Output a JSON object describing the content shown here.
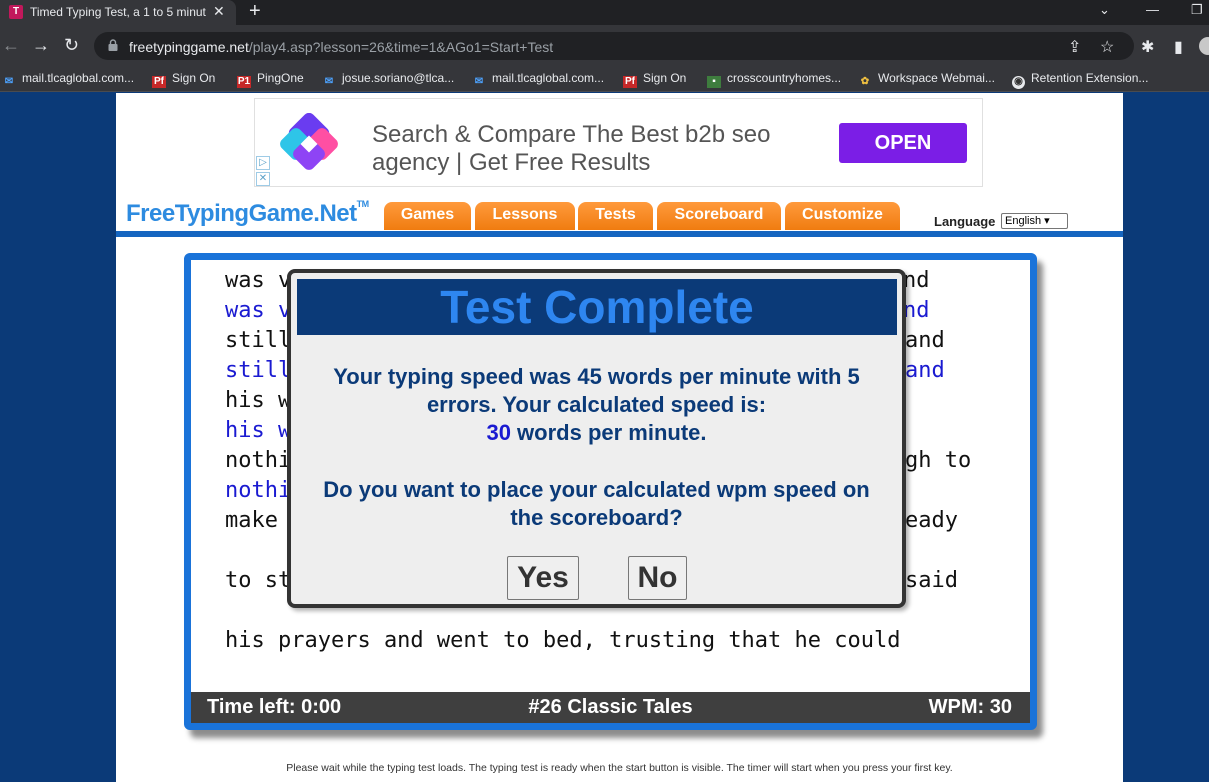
{
  "browser": {
    "tab": {
      "favicon": "T",
      "title": "Timed Typing Test, a 1 to 5 minut",
      "close": "✕"
    },
    "new_tab": "+",
    "window_controls": {
      "minimize": "⌄",
      "restore": "—",
      "maximize": "❐"
    },
    "nav": {
      "back": "←",
      "forward": "→",
      "reload": "↻"
    },
    "url_host": "freetypinggame.net",
    "url_path": "/play4.asp?lesson=26&time=1&AGo1=Start+Test",
    "omnibox_icons": {
      "share": "⇪",
      "star": "☆"
    },
    "extension_icons": {
      "puzzle": "✱",
      "sidebar": "▮"
    },
    "bookmarks": [
      {
        "icon": "mail-icon",
        "glyph": "✉",
        "kind": "mail",
        "label": "mail.tlcaglobal.com..."
      },
      {
        "icon": "pf-icon",
        "glyph": "Pf",
        "kind": "pf",
        "label": "Sign On"
      },
      {
        "icon": "pi-icon",
        "glyph": "P1",
        "kind": "pf",
        "label": "PingOne"
      },
      {
        "icon": "mail-icon",
        "glyph": "✉",
        "kind": "mail",
        "label": "josue.soriano@tlca..."
      },
      {
        "icon": "mail-icon",
        "glyph": "✉",
        "kind": "mail",
        "label": "mail.tlcaglobal.com..."
      },
      {
        "icon": "pf-icon",
        "glyph": "Pf",
        "kind": "pf",
        "label": "Sign On"
      },
      {
        "icon": "house-icon",
        "glyph": "▪",
        "kind": "cc",
        "label": "crosscountryhomes..."
      },
      {
        "icon": "workspace-icon",
        "glyph": "✿",
        "kind": "ws",
        "label": "Workspace Webmai..."
      },
      {
        "icon": "globe-icon",
        "glyph": "◉",
        "kind": "re",
        "label": "Retention Extension..."
      }
    ]
  },
  "ad": {
    "text": "Search & Compare The Best b2b seo agency | Get Free Results",
    "button": "OPEN",
    "adchoices": "▷",
    "close": "✕"
  },
  "site": {
    "logo": "FreeTypingGame.Net",
    "logo_tm": "TM",
    "menu": [
      "Games",
      "Lessons",
      "Tests",
      "Scoreboard",
      "Customize"
    ],
    "language_label": "Language",
    "language_value": "English ▾"
  },
  "test": {
    "lines": [
      {
        "text": "was v",
        "tail": "nd",
        "typed": false
      },
      {
        "text": "was v",
        "tail": "nd",
        "typed": true
      },
      {
        "text": "still",
        "tail": "and",
        "typed": false
      },
      {
        "text": "still",
        "tail": "and",
        "typed": true
      },
      {
        "text": "his w",
        "tail": "",
        "typed": false
      },
      {
        "text": "his w",
        "tail": "",
        "typed": true
      },
      {
        "text": "nothi",
        "tail": "gh to",
        "typed": false
      },
      {
        "text": "nothi",
        "tail": "",
        "typed": true
      },
      {
        "text": "make",
        "tail": "eady",
        "typed": false
      },
      {
        "text": "",
        "tail": "",
        "typed": false
      },
      {
        "text": "to st",
        "tail": "said",
        "typed": false
      },
      {
        "text": "",
        "tail": "",
        "typed": false
      },
      {
        "text": "his prayers and went to bed, trusting that he could",
        "tail": "",
        "typed": false
      }
    ],
    "status": {
      "time_left": "Time left: 0:00",
      "lesson": "#26 Classic Tales",
      "wpm": "WPM: 30"
    }
  },
  "modal": {
    "title": "Test Complete",
    "line1": "Your typing speed was 45 words per minute with 5",
    "line2": "errors. Your calculated speed is:",
    "calc_wpm": "30",
    "line3_suffix": " words per minute.",
    "question_line1": "Do you want to place your calculated wpm speed on",
    "question_line2": "the scoreboard?",
    "yes": "Yes",
    "no": "No"
  },
  "footnote": "Please wait while the typing test loads. The typing test is ready when the start button is visible. The timer will start when you press your first key."
}
